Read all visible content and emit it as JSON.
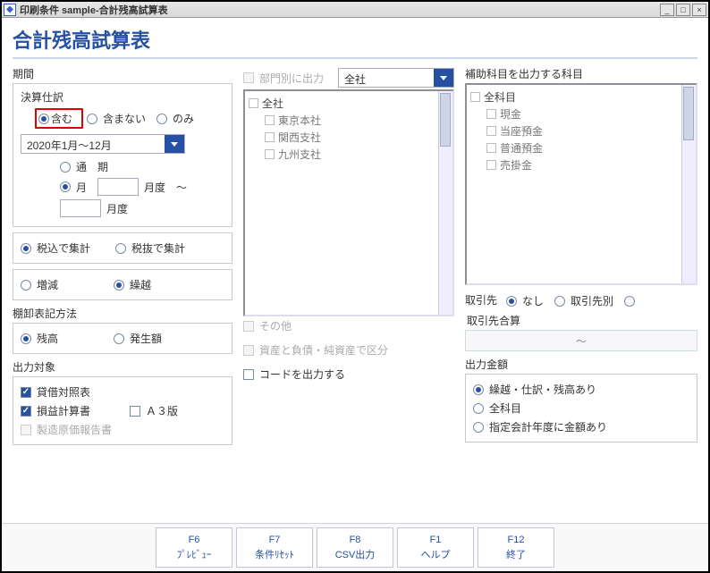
{
  "window": {
    "title": "印刷条件 sample-合計残高試算表"
  },
  "page_title": "合計残高試算表",
  "period": {
    "label": "期間",
    "closing_label": "決算仕訳",
    "closing_options": {
      "include": "含む",
      "exclude": "含まない",
      "only": "のみ"
    },
    "range_selected": "2020年1月～12月",
    "period_options": {
      "full": "通　期",
      "month": "月"
    },
    "month_label_from": "月度",
    "month_label_sep": "～",
    "month_label_to": "月度"
  },
  "aggregate": {
    "with_tax": "税込で集計",
    "without_tax": "税抜で集計"
  },
  "flux": {
    "change": "増減",
    "carryover": "繰越"
  },
  "inventory_label": "棚卸表記方法",
  "inventory": {
    "balance": "残高",
    "occur": "発生額"
  },
  "output_target_label": "出力対象",
  "output_target": {
    "bs": "貸借対照表",
    "pl": "損益計算書",
    "a3": "Ａ３版",
    "mfg": "製造原価報告書"
  },
  "mid": {
    "by_dept": "部門別に出力",
    "dept_selected": "全社",
    "dept_tree": {
      "root": "全社",
      "children": [
        "東京本社",
        "関西支社",
        "九州支社"
      ]
    },
    "other": "その他",
    "split_assets": "資産と負債・純資産で区分",
    "output_code": "コードを出力する"
  },
  "right": {
    "sub_accounts_label": "補助科目を出力する科目",
    "accounts_tree": {
      "root": "全科目",
      "children": [
        "現金",
        "当座預金",
        "普通預金",
        "売掛金"
      ]
    },
    "partner_label": "取引先",
    "partner_options": {
      "none": "なし",
      "by": "取引先別",
      "merge": "取引先合算"
    },
    "range_sep": "～",
    "output_amount_label": "出力金額",
    "output_amount": {
      "carryover": "繰越・仕訳・残高あり",
      "all": "全科目",
      "designated": "指定会計年度に金額あり"
    }
  },
  "footer": {
    "f6": {
      "key": "F6",
      "label": "ﾌﾟﾚﾋﾞｭｰ"
    },
    "f7": {
      "key": "F7",
      "label": "条件ﾘｾｯﾄ"
    },
    "f8": {
      "key": "F8",
      "label": "CSV出力"
    },
    "f1": {
      "key": "F1",
      "label": "ヘルプ"
    },
    "f12": {
      "key": "F12",
      "label": "終了"
    }
  }
}
